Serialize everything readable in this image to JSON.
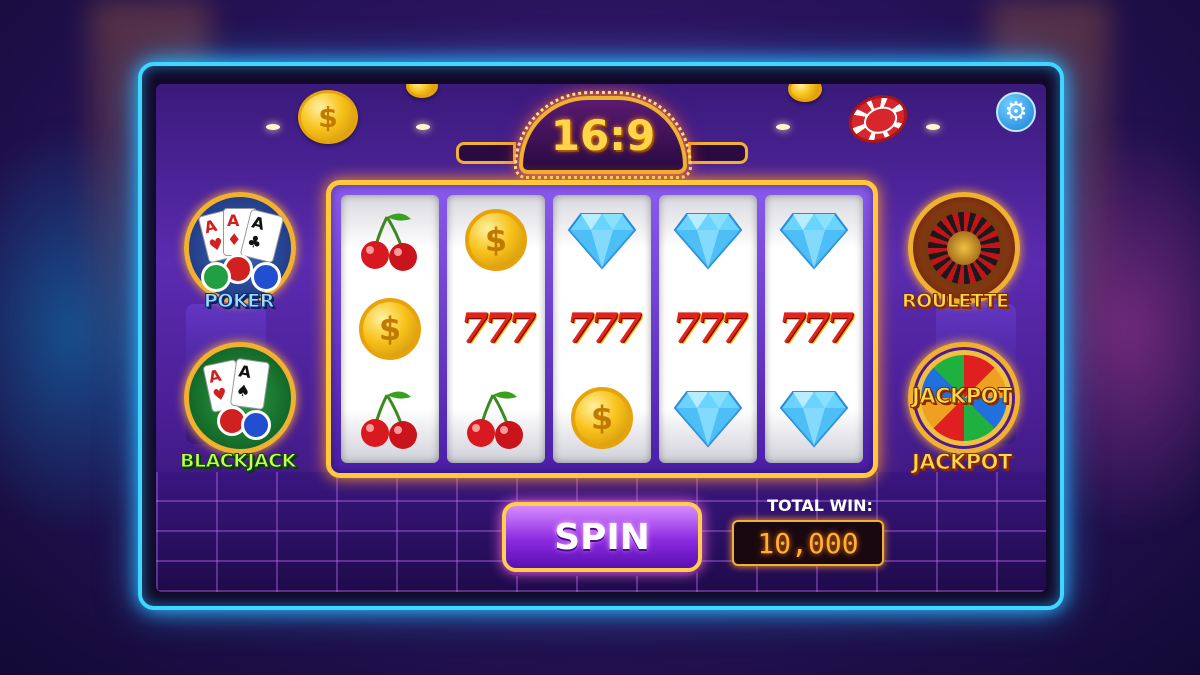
{
  "title": "16:9",
  "settings_icon": "gear-icon",
  "games_left": [
    {
      "label": "POKER",
      "icon": "poker-cards-icon"
    },
    {
      "label": "BLACKJACK",
      "icon": "blackjack-cards-icon"
    }
  ],
  "games_right": [
    {
      "label": "ROULETTE",
      "icon": "roulette-wheel-icon"
    },
    {
      "label": "JACKPOT",
      "wheel_text": "JACKPOT",
      "icon": "jackpot-wheel-icon"
    }
  ],
  "reels": [
    [
      "cherry",
      "coin",
      "cherry"
    ],
    [
      "coin",
      "777",
      "cherry"
    ],
    [
      "diamond",
      "777",
      "coin"
    ],
    [
      "diamond",
      "777",
      "diamond"
    ],
    [
      "diamond",
      "777",
      "diamond"
    ]
  ],
  "symbols": {
    "seven_text": "777",
    "coin_text": "$"
  },
  "spin_label": "SPIN",
  "total_win_label": "TOTAL WIN:",
  "total_win_value": "10,000",
  "colors": {
    "frame_glow": "#3fd6ff",
    "gold": "#ffc83d",
    "spin_purple": "#8a2ae0"
  }
}
